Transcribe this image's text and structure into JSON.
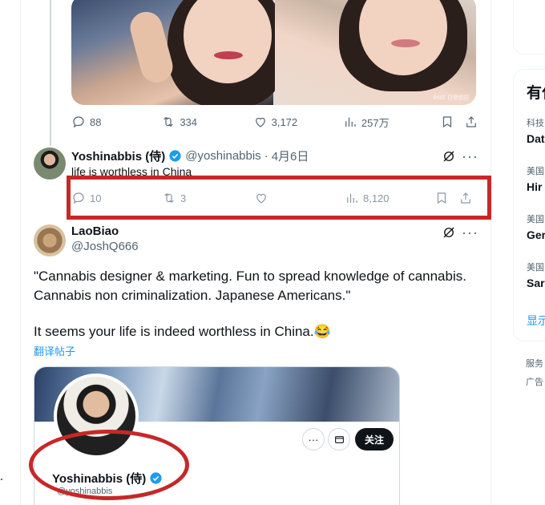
{
  "media": {
    "watermark": "ΦΜΣ 日常你好"
  },
  "tweet1_actions": {
    "replies": "88",
    "retweets": "334",
    "likes": "3,172",
    "views": "257万"
  },
  "reply1": {
    "name": "Yoshinabbis (侍)",
    "handle": "@yoshinabbis",
    "separator": "·",
    "date": "4月6日",
    "text": "life is worthless in China",
    "replies": "10",
    "retweets": "3",
    "likes": "",
    "views": "8,120"
  },
  "reply2": {
    "name": "LaoBiao",
    "handle": "@JoshQ666",
    "bio_quote": "\"Cannabis designer & marketing. Fun to spread knowledge of cannabis. Cannabis non criminalization. Japanese Americans.\"",
    "text": "It seems your life is indeed worthless in China.😂",
    "translate_label": "翻译帖子"
  },
  "profile_card": {
    "name": "Yoshinabbis (侍)",
    "handle": "@yoshinabbis",
    "follow_label": "关注",
    "more_label": "···",
    "message_icon": "mail-icon"
  },
  "sidebar": {
    "heading": "有什",
    "trends": [
      {
        "category": "科技",
        "title": "Dat"
      },
      {
        "category": "美国",
        "title": "Hir"
      },
      {
        "category": "美国",
        "title": "Ger"
      },
      {
        "category": "美国",
        "title": "Sar"
      }
    ],
    "show_more": "显示",
    "footer": [
      "服务",
      "广告"
    ]
  },
  "colors": {
    "accent": "#1d9bf0",
    "annotation": "#c62828",
    "muted": "#536471"
  }
}
